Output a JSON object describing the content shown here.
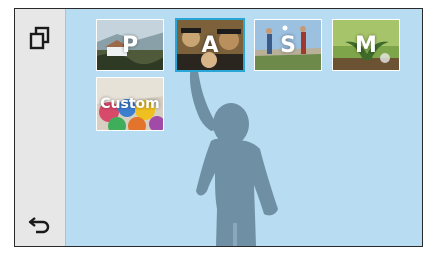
{
  "sidebar": {
    "top_button_icon": "copy-overlay-icon",
    "back_button_icon": "return-arrow-icon"
  },
  "modes": [
    {
      "label": "P",
      "selected": false
    },
    {
      "label": "A",
      "selected": true
    },
    {
      "label": "S",
      "selected": false
    },
    {
      "label": "M",
      "selected": false
    },
    {
      "label": "Custom",
      "selected": false
    }
  ],
  "colors": {
    "background": "#b8dcf2",
    "sidebar": "#e7e7e7",
    "selection": "#2aa6d6",
    "silhouette": "#6f8fa4"
  }
}
